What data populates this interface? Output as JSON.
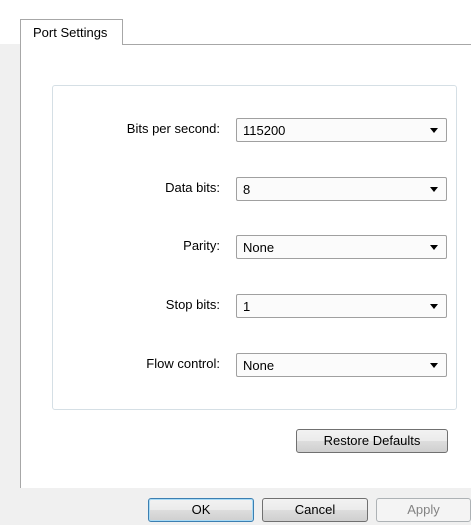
{
  "dialog": {
    "tabs": [
      {
        "label": "Port Settings"
      }
    ]
  },
  "port_settings": {
    "fields": [
      {
        "label": "Bits per second:",
        "value": "115200"
      },
      {
        "label": "Data bits:",
        "value": "8"
      },
      {
        "label": "Parity:",
        "value": "None"
      },
      {
        "label": "Stop bits:",
        "value": "1"
      },
      {
        "label": "Flow control:",
        "value": "None"
      }
    ],
    "restore_defaults_label": "Restore Defaults"
  },
  "footer": {
    "ok_label": "OK",
    "cancel_label": "Cancel",
    "apply_label": "Apply",
    "apply_enabled": false
  },
  "icons": {
    "dropdown": "chevron-down-icon"
  }
}
